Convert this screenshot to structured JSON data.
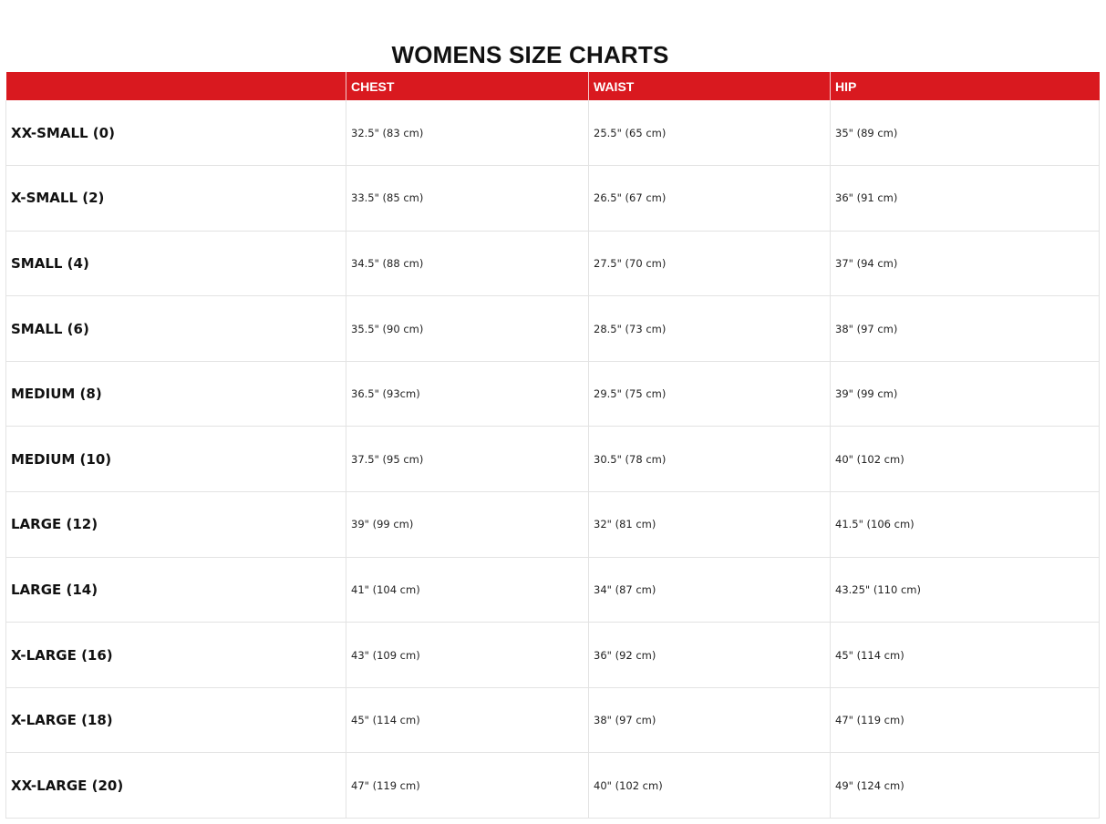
{
  "title": "WOMENS SIZE CHARTS",
  "colors": {
    "header_background": "#d9191f",
    "header_text": "#ffffff",
    "grid_line": "#e3e3e3"
  },
  "table": {
    "headers": [
      "",
      "CHEST",
      "WAIST",
      "HIP"
    ],
    "rows": [
      [
        "XX-SMALL (0)",
        "32.5\" (83 cm)",
        "25.5\" (65 cm)",
        "35\" (89 cm)"
      ],
      [
        "X-SMALL (2)",
        "33.5\" (85 cm)",
        "26.5\" (67 cm)",
        "36\" (91 cm)"
      ],
      [
        "SMALL (4)",
        "34.5\" (88 cm)",
        "27.5\" (70 cm)",
        "37\" (94 cm)"
      ],
      [
        "SMALL (6)",
        "35.5\" (90 cm)",
        "28.5\" (73 cm)",
        "38\" (97 cm)"
      ],
      [
        "MEDIUM (8)",
        "36.5\" (93cm)",
        "29.5\" (75 cm)",
        "39\" (99 cm)"
      ],
      [
        "MEDIUM (10)",
        "37.5\" (95 cm)",
        "30.5\" (78 cm)",
        "40\" (102 cm)"
      ],
      [
        "LARGE (12)",
        "39\" (99 cm)",
        "32\" (81 cm)",
        "41.5\" (106 cm)"
      ],
      [
        "LARGE (14)",
        "41\" (104 cm)",
        "34\" (87 cm)",
        "43.25\" (110 cm)"
      ],
      [
        "X-LARGE (16)",
        "43\" (109 cm)",
        "36\" (92 cm)",
        "45\" (114 cm)"
      ],
      [
        "X-LARGE (18)",
        "45\" (114 cm)",
        "38\" (97 cm)",
        "47\" (119 cm)"
      ],
      [
        "XX-LARGE (20)",
        "47\" (119 cm)",
        "40\" (102 cm)",
        "49\" (124 cm)"
      ]
    ]
  }
}
